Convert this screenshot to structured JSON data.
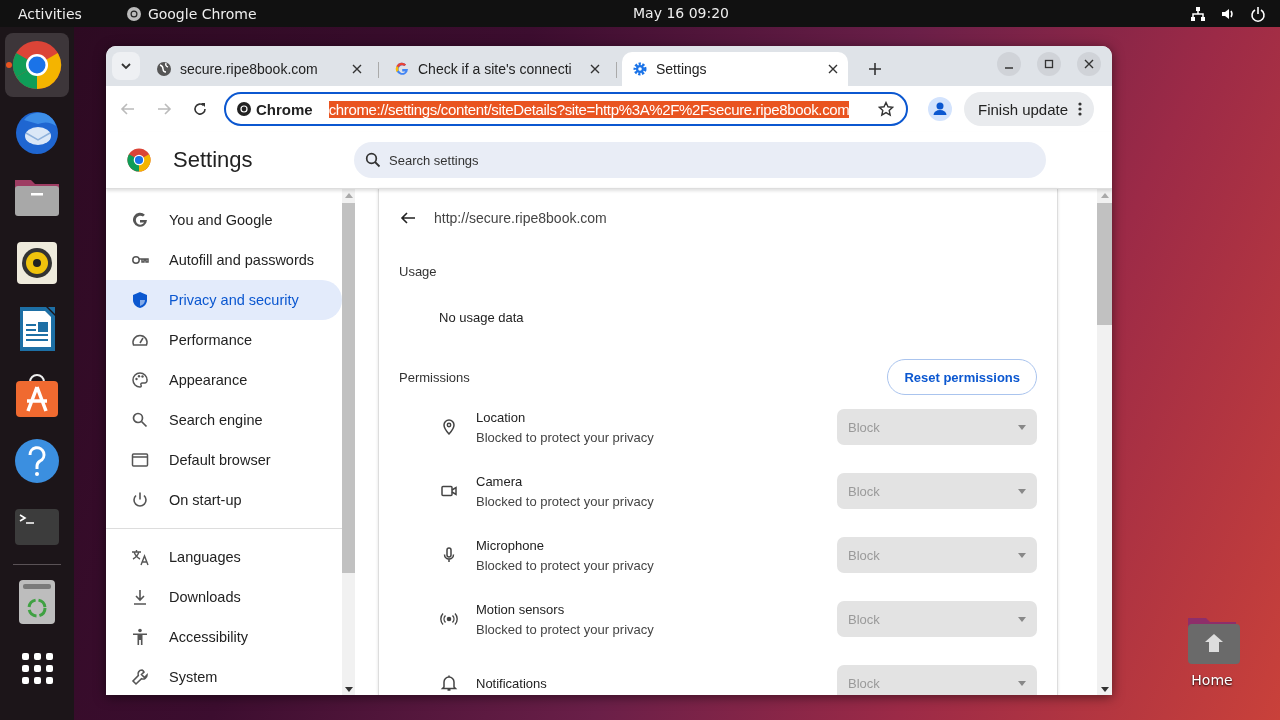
{
  "top_bar": {
    "activities": "Activities",
    "app": "Google Chrome",
    "clock": "May 16  09:20"
  },
  "dock": [
    {
      "kind": "chrome",
      "running": true
    },
    {
      "kind": "mail",
      "running": false
    },
    {
      "kind": "files",
      "running": false
    },
    {
      "kind": "audio",
      "running": false
    },
    {
      "kind": "writer",
      "running": false
    },
    {
      "kind": "store",
      "running": false
    },
    {
      "kind": "help",
      "running": false
    },
    {
      "kind": "terminal",
      "running": false
    },
    {
      "kind": "trash",
      "running": false
    },
    {
      "kind": "apps",
      "running": false
    }
  ],
  "desktop_icons": [
    {
      "label": "Home"
    }
  ],
  "browser": {
    "tabs": [
      {
        "kind": "globe",
        "title": "secure.ripe8book.com",
        "selected": false
      },
      {
        "kind": "google",
        "title": "Check if a site's connecti",
        "selected": false
      },
      {
        "kind": "gear",
        "title": "Settings",
        "selected": true
      }
    ],
    "address": {
      "chip": "Chrome",
      "url": "chrome://settings/content/siteDetails?site=http%3A%2F%2Fsecure.ripe8book.com",
      "selected": true
    },
    "update_button": "Finish update"
  },
  "settings": {
    "title": "Settings",
    "search_placeholder": "Search settings",
    "nav_groups": [
      [
        {
          "kind": "google",
          "label": "You and Google",
          "selected": false
        },
        {
          "kind": "key",
          "label": "Autofill and passwords",
          "selected": false
        },
        {
          "kind": "shield",
          "label": "Privacy and security",
          "selected": true
        },
        {
          "kind": "gauge",
          "label": "Performance",
          "selected": false
        },
        {
          "kind": "palette",
          "label": "Appearance",
          "selected": false
        },
        {
          "kind": "search",
          "label": "Search engine",
          "selected": false
        },
        {
          "kind": "browser",
          "label": "Default browser",
          "selected": false
        },
        {
          "kind": "power",
          "label": "On start-up",
          "selected": false
        }
      ],
      [
        {
          "kind": "translate",
          "label": "Languages",
          "selected": false
        },
        {
          "kind": "download",
          "label": "Downloads",
          "selected": false
        },
        {
          "kind": "accessibility",
          "label": "Accessibility",
          "selected": false
        },
        {
          "kind": "wrench",
          "label": "System",
          "selected": false
        }
      ]
    ]
  },
  "site": {
    "url": "http://secure.ripe8book.com",
    "usage_heading": "Usage",
    "usage": "No usage data",
    "permissions_heading": "Permissions",
    "reset_button": "Reset permissions",
    "permissions": [
      {
        "kind": "location",
        "name": "Location",
        "status": "Blocked to protect your privacy",
        "value": "Block",
        "disabled": true
      },
      {
        "kind": "camera",
        "name": "Camera",
        "status": "Blocked to protect your privacy",
        "value": "Block",
        "disabled": true
      },
      {
        "kind": "microphone",
        "name": "Microphone",
        "status": "Blocked to protect your privacy",
        "value": "Block",
        "disabled": true
      },
      {
        "kind": "motion",
        "name": "Motion sensors",
        "status": "Blocked to protect your privacy",
        "value": "Block",
        "disabled": true
      },
      {
        "kind": "bell",
        "name": "Notifications",
        "value": "Block",
        "disabled": true
      }
    ]
  }
}
